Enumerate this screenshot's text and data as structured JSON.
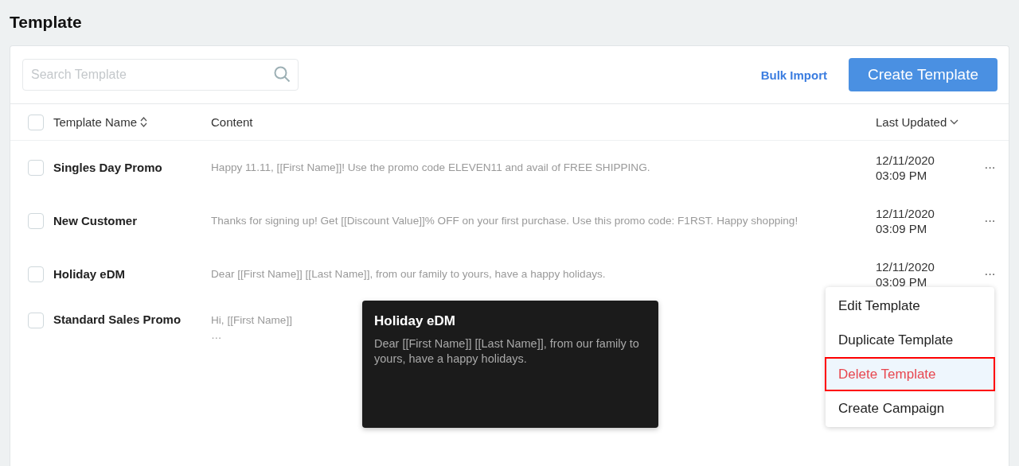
{
  "page_title": "Template",
  "search": {
    "placeholder": "Search Template"
  },
  "bulk_import": "Bulk Import",
  "create_button": "Create Template",
  "table": {
    "select_all_checked": false,
    "columns": [
      {
        "label": "Template Name"
      },
      {
        "label": "Content"
      },
      {
        "label": "Last Updated"
      }
    ],
    "rows": [
      {
        "checked": false,
        "name": "Singles Day Promo",
        "content": [
          "Happy 11.11, [[First Name]]! Use the promo code ELEVEN11 and avail of FREE SHIPPING."
        ],
        "date": "12/11/2020",
        "time": "03:09 PM",
        "more": "···"
      },
      {
        "checked": false,
        "name": "New Customer",
        "content": [
          "Thanks for signing up! Get [[Discount Value]]% OFF on your first purchase. Use this promo code: F1RST. Happy shopping!"
        ],
        "date": "12/11/2020",
        "time": "03:09 PM",
        "more": "···"
      },
      {
        "checked": false,
        "name": "Holiday eDM",
        "content": [
          "Dear [[First Name]] [[Last Name]], from our family to yours, have a happy holidays."
        ],
        "date": "12/11/2020",
        "time": "03:09 PM",
        "more": "···"
      },
      {
        "checked": false,
        "name": "Standard Sales Promo",
        "content": [
          "Hi, [[First Name]]",
          "…"
        ]
      }
    ]
  },
  "tooltip": {
    "title": "Holiday eDM",
    "body": "Dear [[First Name]] [[Last Name]], from our family to yours, have a happy holidays."
  },
  "menu": {
    "items": [
      {
        "label": "Edit Template",
        "kind": "normal",
        "selected": false
      },
      {
        "label": "Duplicate Template",
        "kind": "normal",
        "selected": false
      },
      {
        "label": "Delete Template",
        "kind": "danger",
        "selected": true
      },
      {
        "label": "Create Campaign",
        "kind": "normal",
        "selected": false
      }
    ]
  }
}
